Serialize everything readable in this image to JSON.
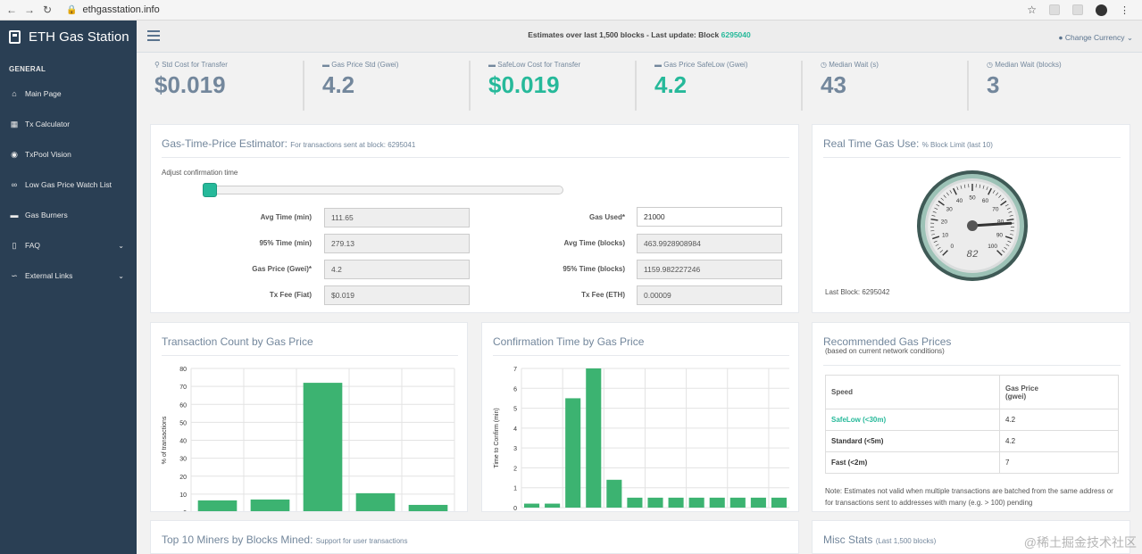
{
  "browser": {
    "url": "ethgasstation.info"
  },
  "sidebar": {
    "brand": "ETH Gas Station",
    "section": "GENERAL",
    "items": [
      {
        "label": "Main Page",
        "icon": "home-icon"
      },
      {
        "label": "Tx Calculator",
        "icon": "calculator-icon"
      },
      {
        "label": "TxPool Vision",
        "icon": "eye-icon"
      },
      {
        "label": "Low Gas Price Watch List",
        "icon": "binoculars-icon"
      },
      {
        "label": "Gas Burners",
        "icon": "car-icon"
      },
      {
        "label": "FAQ",
        "icon": "book-icon"
      },
      {
        "label": "External Links",
        "icon": "link-icon"
      }
    ]
  },
  "header": {
    "estimate_text": "Estimates over last 1,500 blocks - Last update: Block",
    "block": "6295040",
    "currency_label": "Change Currency"
  },
  "tiles": [
    {
      "label": "Std Cost for Transfer",
      "value": "$0.019",
      "color": "#73879c"
    },
    {
      "label": "Gas Price Std (Gwei)",
      "value": "4.2",
      "color": "#73879c"
    },
    {
      "label": "SafeLow Cost for Transfer",
      "value": "$0.019",
      "color": "#26b99a"
    },
    {
      "label": "Gas Price SafeLow (Gwei)",
      "value": "4.2",
      "color": "#26b99a"
    },
    {
      "label": "Median Wait (s)",
      "value": "43",
      "color": "#73879c"
    },
    {
      "label": "Median Wait (blocks)",
      "value": "3",
      "color": "#73879c"
    }
  ],
  "estimator": {
    "title": "Gas-Time-Price Estimator:",
    "subtitle": "For transactions sent at block: 6295041",
    "adjust_label": "Adjust confirmation time",
    "slider_fraction": 0.0,
    "left_rows": [
      {
        "label": "Avg Time (min)",
        "value": "111.65"
      },
      {
        "label": "95% Time (min)",
        "value": "279.13"
      },
      {
        "label": "Gas Price (Gwei)*",
        "value": "4.2"
      },
      {
        "label": "Tx Fee (Fiat)",
        "value": "$0.019"
      }
    ],
    "right_rows": [
      {
        "label": "Gas Used*",
        "value": "21000"
      },
      {
        "label": "Avg Time (blocks)",
        "value": "463.9928908984"
      },
      {
        "label": "95% Time (blocks)",
        "value": "1159.982227246"
      },
      {
        "label": "Tx Fee (ETH)",
        "value": "0.00009"
      }
    ]
  },
  "realtime": {
    "title": "Real Time Gas Use:",
    "subtitle": "% Block Limit (last 10)",
    "gauge_value": 82,
    "gauge_display": "82",
    "gauge_ticks": [
      "0",
      "10",
      "20",
      "30",
      "40",
      "50",
      "60",
      "70",
      "80",
      "90",
      "100"
    ],
    "last_block": "Last Block: 6295042"
  },
  "charts": {
    "txcount": {
      "title": "Transaction Count by Gas Price",
      "ylabel": "% of transactions"
    },
    "conftime": {
      "title": "Confirmation Time by Gas Price",
      "ylabel": "Time to Confirm (min)"
    }
  },
  "chart_data": [
    {
      "type": "bar",
      "title": "Transaction Count by Gas Price",
      "ylabel": "% of transactions",
      "ylim": [
        0,
        80
      ],
      "yticks": [
        "0",
        "10",
        "20",
        "30",
        "40",
        "50",
        "60",
        "70",
        "80"
      ],
      "values": [
        6.5,
        7,
        72,
        10.5,
        4
      ],
      "color": "#3cb371"
    },
    {
      "type": "bar",
      "title": "Confirmation Time by Gas Price",
      "ylabel": "Time to Confirm (min)",
      "ylim": [
        0,
        7
      ],
      "yticks": [
        "0",
        "1",
        "2",
        "3",
        "4",
        "5",
        "6",
        "7"
      ],
      "values": [
        0.2,
        0.2,
        5.5,
        7.0,
        1.4,
        0.5,
        0.5,
        0.5,
        0.5,
        0.5,
        0.5,
        0.5,
        0.5
      ],
      "color": "#3cb371"
    }
  ],
  "recommended": {
    "title": "Recommended Gas Prices",
    "subtitle": "(based on current network conditions)",
    "col_speed": "Speed",
    "col_price": "Gas Price",
    "col_price_unit": "(gwei)",
    "rows": [
      {
        "speed": "SafeLow (<30m)",
        "price": "4.2"
      },
      {
        "speed": "Standard (<5m)",
        "price": "4.2"
      },
      {
        "speed": "Fast (<2m)",
        "price": "7"
      }
    ],
    "note": "Note: Estimates not valid when multiple transactions are batched from the same address or for transactions sent to addresses with many (e.g. > 100) pending"
  },
  "miners": {
    "title": "Top 10 Miners by Blocks Mined:",
    "subtitle": "Support for user transactions"
  },
  "misc": {
    "title": "Misc Stats",
    "subtitle": "(Last 1,500 blocks)"
  },
  "watermark": "@稀土掘金技术社区"
}
